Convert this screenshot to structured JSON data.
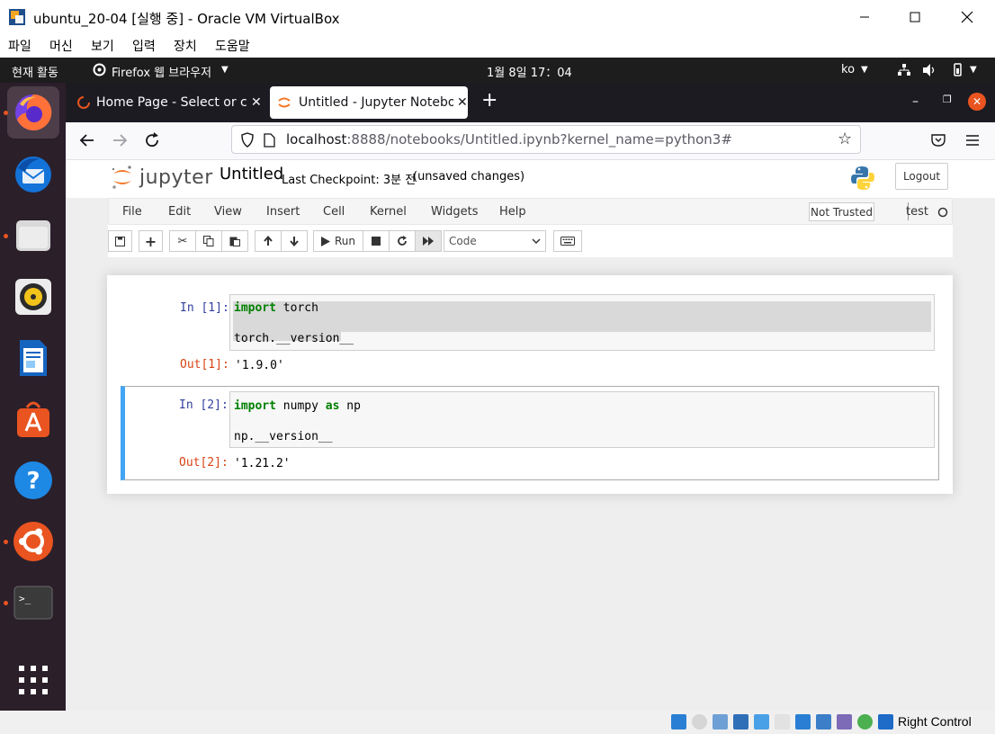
{
  "window": {
    "title": "ubuntu_20-04 [실행 중] - Oracle VM VirtualBox",
    "menu": [
      "파일",
      "머신",
      "보기",
      "입력",
      "장치",
      "도움말"
    ]
  },
  "ubuntu_topbar": {
    "activities": "현재 활동",
    "app_menu": "Firefox 웹 브라우저",
    "clock": "1월 8일  17：04",
    "input_method": "ko"
  },
  "firefox": {
    "tabs": [
      {
        "label": "Home Page - Select or create"
      },
      {
        "label": "Untitled - Jupyter Notebook"
      }
    ],
    "url_host": "localhost",
    "url_rest": ":8888/notebooks/Untitled.ipynb?kernel_name=python3#"
  },
  "jupyter": {
    "logo_text": "jupyter",
    "notebook_name": "Untitled",
    "checkpoint": "Last Checkpoint: 3분 전",
    "unsaved": "(unsaved changes)",
    "logout": "Logout",
    "menu": [
      "File",
      "Edit",
      "View",
      "Insert",
      "Cell",
      "Kernel",
      "Widgets",
      "Help"
    ],
    "trust": "Not Trusted",
    "kernel_name": "test",
    "run_label": "Run",
    "cell_type": "Code",
    "cells": [
      {
        "in_prompt": "In [1]:",
        "code_lines": [
          {
            "kw": "import",
            "rest": " torch"
          },
          {
            "kw": "",
            "rest": "torch.__version__"
          }
        ],
        "out_prompt": "Out[1]:",
        "output": "'1.9.0'"
      },
      {
        "in_prompt": "In [2]:",
        "code_lines": [
          {
            "kw": "import",
            "rest": " numpy ",
            "kw2": "as",
            "rest2": " np"
          },
          {
            "kw": "",
            "rest": "np.__version__"
          }
        ],
        "out_prompt": "Out[2]:",
        "output": "'1.21.2'"
      }
    ]
  },
  "statusbar": {
    "host_key": "Right Control"
  },
  "colors": {
    "ubuntu_orange": "#e95420",
    "jupyter_orange": "#f37726",
    "selected_cell": "#42a5f5",
    "in_prompt": "#303f9f",
    "out_prompt": "#d84315",
    "keyword": "#008000"
  }
}
